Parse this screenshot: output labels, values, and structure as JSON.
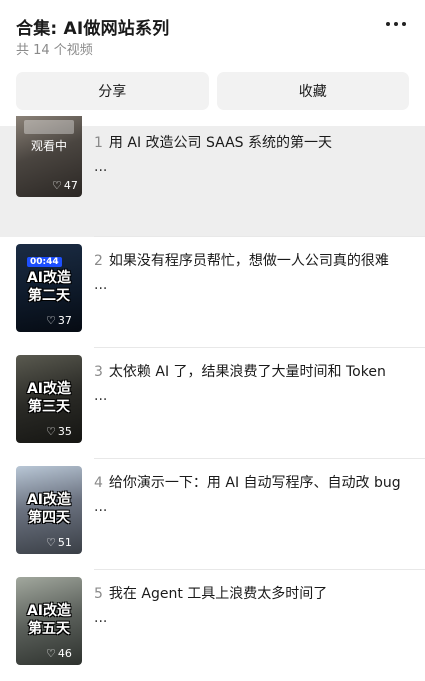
{
  "header": {
    "title": "合集: AI做网站系列",
    "subtitle": "共 14 个视频",
    "more_icon": "more-dots-icon"
  },
  "actions": {
    "share_label": "分享",
    "favorite_label": "收藏"
  },
  "items": [
    {
      "num": "1",
      "title": "用 AI 改造公司 SAAS 系统的第一天",
      "desc": "...",
      "watching": "观看中",
      "likes": "47",
      "overlay_ai": "",
      "overlay_day": "",
      "time_badge": ""
    },
    {
      "num": "2",
      "title": "如果没有程序员帮忙，想做一人公司真的很难",
      "desc": "...",
      "watching": "",
      "likes": "37",
      "overlay_ai": "AI改造",
      "overlay_day": "第二天",
      "time_badge": "00:44"
    },
    {
      "num": "3",
      "title": "太依赖 AI 了，结果浪费了大量时间和 Token",
      "desc": "...",
      "watching": "",
      "likes": "35",
      "overlay_ai": "AI改造",
      "overlay_day": "第三天",
      "time_badge": ""
    },
    {
      "num": "4",
      "title": "给你演示一下：用 AI 自动写程序、自动改 bug",
      "desc": "...",
      "watching": "",
      "likes": "51",
      "overlay_ai": "AI改造",
      "overlay_day": "第四天",
      "time_badge": ""
    },
    {
      "num": "5",
      "title": "我在 Agent 工具上浪费太多时间了",
      "desc": "...",
      "watching": "",
      "likes": "46",
      "overlay_ai": "AI改造",
      "overlay_day": "第五天",
      "time_badge": ""
    }
  ],
  "colors": {
    "thumb_1": "#4a4540",
    "thumb_2": "#0e1a2a",
    "thumb_3": "#2a2a26",
    "thumb_4": "#6b7280",
    "thumb_5": "#5a5f5a",
    "active_row": "#eeeeee"
  }
}
